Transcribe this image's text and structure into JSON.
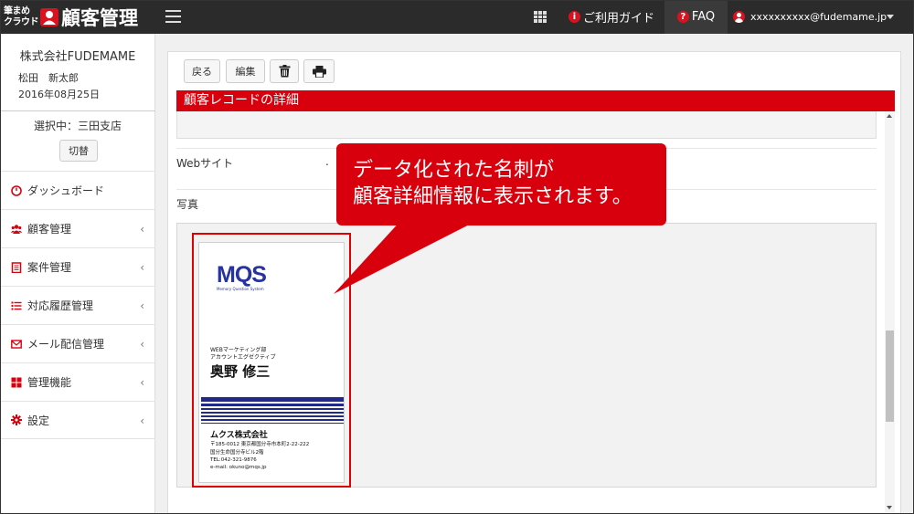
{
  "app": {
    "logo_small_line1": "筆まめ",
    "logo_small_line2": "クラウド",
    "logo_title": "顧客管理"
  },
  "topbar": {
    "guide_icon": "i",
    "guide_label": "ご利用ガイド",
    "faq_icon": "?",
    "faq_label": "FAQ",
    "user_email": "xxxxxxxxxx@fudemame.jp"
  },
  "sidebar": {
    "company": "株式会社FUDEMAME",
    "user_name": "松田　新太郎",
    "date": "2016年08月25日",
    "branch": "選択中：三田支店",
    "switch_label": "切替",
    "items": [
      {
        "label": "ダッシュボード",
        "icon": "dashboard-icon",
        "chevron": ""
      },
      {
        "label": "顧客管理",
        "icon": "users-icon",
        "chevron": "‹"
      },
      {
        "label": "案件管理",
        "icon": "clipboard-icon",
        "chevron": "‹"
      },
      {
        "label": "対応履歴管理",
        "icon": "list-icon",
        "chevron": "‹"
      },
      {
        "label": "メール配信管理",
        "icon": "mail-icon",
        "chevron": "‹"
      },
      {
        "label": "管理機能",
        "icon": "grid-icon",
        "chevron": "‹"
      },
      {
        "label": "設定",
        "icon": "gear-icon",
        "chevron": "‹"
      }
    ]
  },
  "toolbar": {
    "back_label": "戻る",
    "edit_label": "編集"
  },
  "record": {
    "title": "顧客レコードの詳細",
    "website_label": "Webサイト",
    "website_value": ".",
    "photo_label": "写真"
  },
  "card": {
    "logo": "MQS",
    "logo_sub": "Memory Question System",
    "dept_line1": "WEBマーケティング部",
    "dept_line2": "アカウントエグゼクティブ",
    "person": "奥野 修三",
    "company": "ムクス株式会社",
    "address1": "〒185-0012 東京都国分寺市本町2-22-222",
    "address2": "国分生命国分寺ビル2階",
    "tel": "TEL:042-321-9876",
    "email": "e-mail: okuno@mqs.jp"
  },
  "callout": {
    "line1": "データ化された名刺が",
    "line2": "顧客詳細情報に表示されます。"
  },
  "colors": {
    "topbar": "#2b2b2b",
    "accent_red": "#d9000d",
    "card_blue": "#1f2a8a",
    "main_bg": "#f0f0f0"
  }
}
